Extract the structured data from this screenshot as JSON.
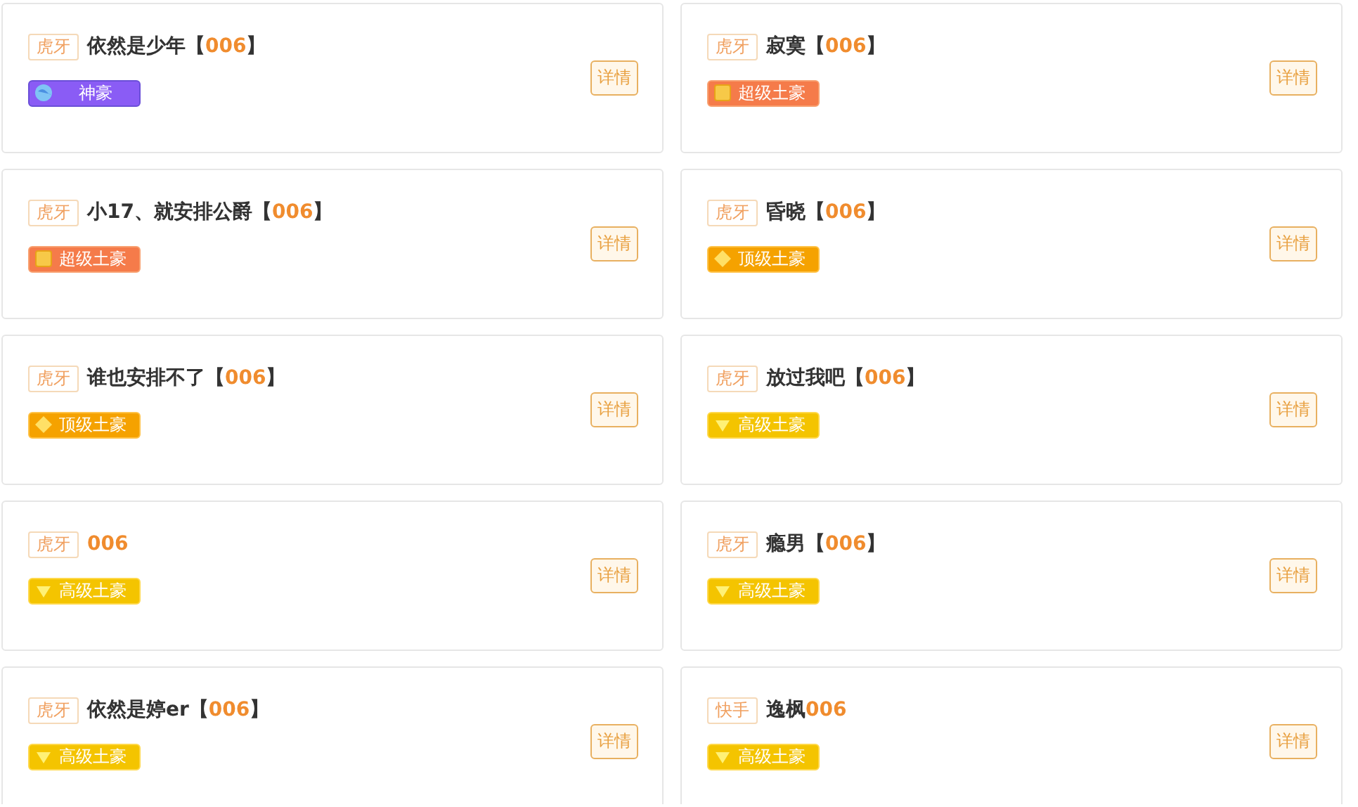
{
  "cards": [
    {
      "platform": "虎牙",
      "name": "依然是少年【",
      "code": "006",
      "after": "】",
      "badge": {
        "kind": "shenhao",
        "label": "神豪"
      },
      "button": "详情"
    },
    {
      "platform": "虎牙",
      "name": "寂寞【",
      "code": "006",
      "after": "】",
      "badge": {
        "kind": "super",
        "label": "超级土豪"
      },
      "button": "详情"
    },
    {
      "platform": "虎牙",
      "name": "小17、就安排公爵【",
      "code": "006",
      "after": "】",
      "badge": {
        "kind": "super",
        "label": "超级土豪"
      },
      "button": "详情"
    },
    {
      "platform": "虎牙",
      "name": "昏晓【",
      "code": "006",
      "after": "】",
      "badge": {
        "kind": "top",
        "label": "顶级土豪"
      },
      "button": "详情"
    },
    {
      "platform": "虎牙",
      "name": "谁也安排不了【",
      "code": "006",
      "after": "】",
      "badge": {
        "kind": "top",
        "label": "顶级土豪"
      },
      "button": "详情"
    },
    {
      "platform": "虎牙",
      "name": "放过我吧【",
      "code": "006",
      "after": "】",
      "badge": {
        "kind": "senior",
        "label": "高级土豪"
      },
      "button": "详情"
    },
    {
      "platform": "虎牙",
      "code": "006",
      "badge": {
        "kind": "senior",
        "label": "高级土豪"
      },
      "button": "详情"
    },
    {
      "platform": "虎牙",
      "name": "瘾男【",
      "code": "006",
      "after": "】",
      "badge": {
        "kind": "senior",
        "label": "高级土豪"
      },
      "button": "详情"
    },
    {
      "platform": "虎牙",
      "name": "依然是婷er【",
      "code": "006",
      "after": "】",
      "badge": {
        "kind": "senior",
        "label": "高级土豪"
      },
      "button": "详情"
    },
    {
      "platform": "快手",
      "name": "逸枫",
      "code": "006",
      "badge": {
        "kind": "senior",
        "label": "高级土豪"
      },
      "button": "详情"
    }
  ]
}
